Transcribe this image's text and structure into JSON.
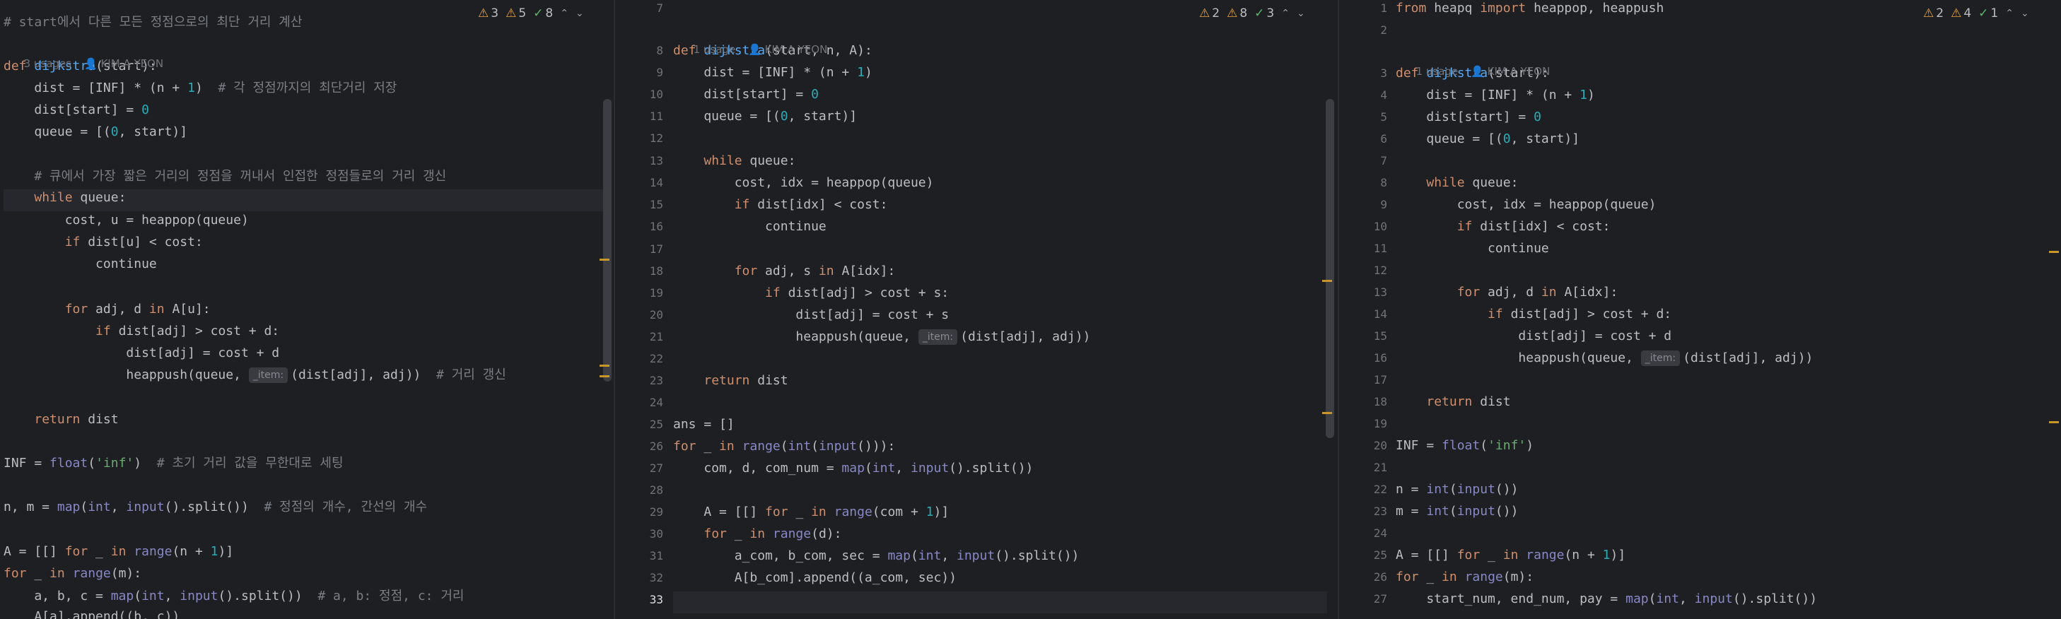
{
  "panes": [
    {
      "inspection": {
        "warn1": "3",
        "warn2": "5",
        "ok": "8"
      },
      "hints": {
        "usages": "3 usages",
        "author": "KIM A YEON"
      },
      "lines": [
        "# start에서 다른 모든 정점으로의 최단 거리 계산",
        "def dijkstra(start):",
        "    dist = [INF] * (n + 1)  # 각 정점까지의 최단거리 저장",
        "    dist[start] = 0",
        "    queue = [(0, start)]",
        "",
        "    # 큐에서 가장 짧은 거리의 정점을 꺼내서 인접한 정점들로의 거리 갱신",
        "    while queue:",
        "        cost, u = heappop(queue)",
        "        if dist[u] < cost:",
        "            continue",
        "",
        "        for adj, d in A[u]:",
        "            if dist[adj] > cost + d:",
        "                dist[adj] = cost + d",
        "                heappush(queue, _item: (dist[adj], adj))  # 거리 갱신",
        "",
        "    return dist",
        "",
        "INF = float('inf')  # 초기 거리 값을 무한대로 세팅",
        "",
        "n, m = map(int, input().split())  # 정점의 개수, 간선의 개수",
        "",
        "A = [[] for _ in range(n + 1)]",
        "for _ in range(m):",
        "    a, b, c = map(int, input().split())  # a, b: 정점, c: 거리",
        "    A[a].append((b, c))"
      ]
    },
    {
      "inspection": {
        "warn1": "2",
        "warn2": "8",
        "ok": "3"
      },
      "hints": {
        "usages": "1 usage",
        "author": "KIM A YEON"
      },
      "line_numbers": [
        "7",
        "8",
        "9",
        "10",
        "11",
        "12",
        "13",
        "14",
        "15",
        "16",
        "17",
        "18",
        "19",
        "20",
        "21",
        "22",
        "23",
        "24",
        "25",
        "26",
        "27",
        "28",
        "29",
        "30",
        "31",
        "32",
        "33"
      ],
      "lines": [
        "",
        "def dijkstra(start, n, A):",
        "    dist = [INF] * (n + 1)",
        "    dist[start] = 0",
        "    queue = [(0, start)]",
        "",
        "    while queue:",
        "        cost, idx = heappop(queue)",
        "        if dist[idx] < cost:",
        "            continue",
        "",
        "        for adj, s in A[idx]:",
        "            if dist[adj] > cost + s:",
        "                dist[adj] = cost + s",
        "                heappush(queue, _item: (dist[adj], adj))",
        "",
        "    return dist",
        "",
        "ans = []",
        "for _ in range(int(input())):",
        "    com, d, com_num = map(int, input().split())",
        "",
        "    A = [[] for _ in range(com + 1)]",
        "    for _ in range(d):",
        "        a_com, b_com, sec = map(int, input().split())",
        "        A[b_com].append((a_com, sec))",
        ""
      ]
    },
    {
      "inspection": {
        "warn1": "2",
        "warn2": "4",
        "ok": "1"
      },
      "hints": {
        "usages": "1 usage",
        "author": "KIM A YEON"
      },
      "line_numbers": [
        "1",
        "2",
        "3",
        "4",
        "5",
        "6",
        "7",
        "8",
        "9",
        "10",
        "11",
        "12",
        "13",
        "14",
        "15",
        "16",
        "17",
        "18",
        "19",
        "20",
        "21",
        "22",
        "23",
        "24",
        "25",
        "26",
        "27"
      ],
      "lines": [
        "from heapq import heappop, heappush",
        "",
        "def dijkstra(start):",
        "    dist = [INF] * (n + 1)",
        "    dist[start] = 0",
        "    queue = [(0, start)]",
        "",
        "    while queue:",
        "        cost, idx = heappop(queue)",
        "        if dist[idx] < cost:",
        "            continue",
        "",
        "        for adj, d in A[idx]:",
        "            if dist[adj] > cost + d:",
        "                dist[adj] = cost + d",
        "                heappush(queue, _item: (dist[adj], adj))",
        "",
        "    return dist",
        "",
        "INF = float('inf')",
        "",
        "n = int(input())",
        "m = int(input())",
        "",
        "A = [[] for _ in range(n + 1)]",
        "for _ in range(m):",
        "    start_num, end_num, pay = map(int, input().split())"
      ]
    }
  ]
}
